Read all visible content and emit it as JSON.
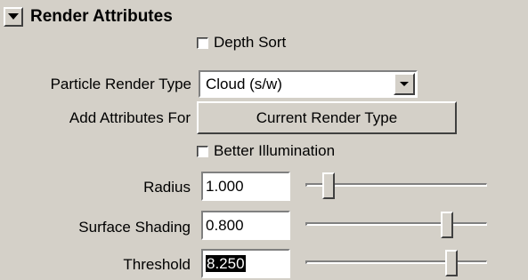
{
  "section": {
    "title": "Render Attributes"
  },
  "depth_sort": {
    "label": "Depth Sort",
    "checked": false
  },
  "particle_render_type": {
    "label": "Particle Render Type",
    "value": "Cloud (s/w)"
  },
  "add_attributes": {
    "label": "Add Attributes For",
    "button_label": "Current Render Type"
  },
  "better_illumination": {
    "label": "Better Illumination",
    "checked": false
  },
  "radius": {
    "label": "Radius",
    "value": "1.000",
    "slider_fraction": 0.1
  },
  "surface_shading": {
    "label": "Surface Shading",
    "value": "0.800",
    "slider_fraction": 0.8
  },
  "threshold": {
    "label": "Threshold",
    "value": "8.250",
    "slider_fraction": 0.825
  },
  "icons": {
    "collapse": "triangle-down-icon",
    "dropdown": "chevron-down-icon"
  },
  "colors": {
    "panel_bg": "#d4d0c8",
    "field_bg": "#ffffff",
    "selection_bg": "#000000"
  }
}
